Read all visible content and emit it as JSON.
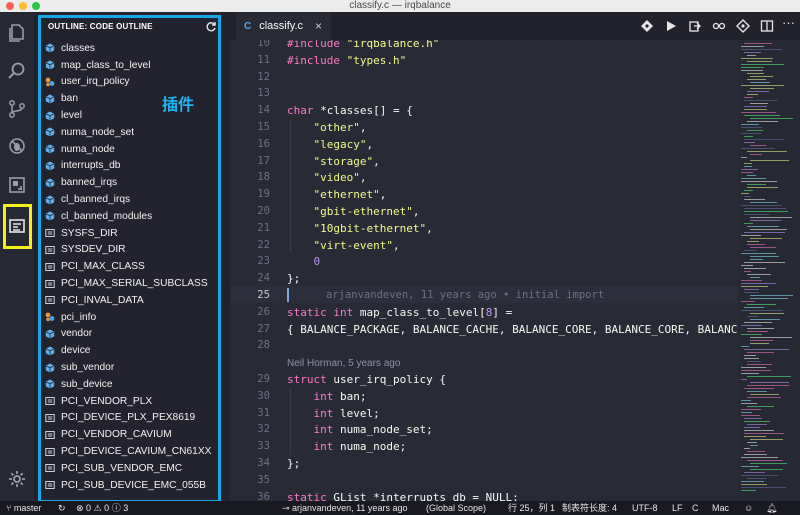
{
  "window": {
    "title": "classify.c — irqbalance"
  },
  "sidebar": {
    "header": "OUTLINE: CODE OUTLINE",
    "annotation": "插件",
    "items": [
      {
        "label": "classes",
        "icon": "variable-icon"
      },
      {
        "label": "map_class_to_level",
        "icon": "variable-icon"
      },
      {
        "label": "user_irq_policy",
        "icon": "struct-icon"
      },
      {
        "label": "ban",
        "icon": "field-icon"
      },
      {
        "label": "level",
        "icon": "field-icon"
      },
      {
        "label": "numa_node_set",
        "icon": "field-icon"
      },
      {
        "label": "numa_node",
        "icon": "field-icon"
      },
      {
        "label": "interrupts_db",
        "icon": "variable-icon"
      },
      {
        "label": "banned_irqs",
        "icon": "variable-icon"
      },
      {
        "label": "cl_banned_irqs",
        "icon": "variable-icon"
      },
      {
        "label": "cl_banned_modules",
        "icon": "variable-icon"
      },
      {
        "label": "SYSFS_DIR",
        "icon": "constant-icon"
      },
      {
        "label": "SYSDEV_DIR",
        "icon": "constant-icon"
      },
      {
        "label": "PCI_MAX_CLASS",
        "icon": "constant-icon"
      },
      {
        "label": "PCI_MAX_SERIAL_SUBCLASS",
        "icon": "constant-icon"
      },
      {
        "label": "PCI_INVAL_DATA",
        "icon": "constant-icon"
      },
      {
        "label": "pci_info",
        "icon": "struct-icon"
      },
      {
        "label": "vendor",
        "icon": "field-icon"
      },
      {
        "label": "device",
        "icon": "field-icon"
      },
      {
        "label": "sub_vendor",
        "icon": "field-icon"
      },
      {
        "label": "sub_device",
        "icon": "field-icon"
      },
      {
        "label": "PCI_VENDOR_PLX",
        "icon": "constant-icon"
      },
      {
        "label": "PCI_DEVICE_PLX_PEX8619",
        "icon": "constant-icon"
      },
      {
        "label": "PCI_VENDOR_CAVIUM",
        "icon": "constant-icon"
      },
      {
        "label": "PCI_DEVICE_CAVIUM_CN61XX",
        "icon": "constant-icon"
      },
      {
        "label": "PCI_SUB_VENDOR_EMC",
        "icon": "constant-icon"
      },
      {
        "label": "PCI_SUB_DEVICE_EMC_055B",
        "icon": "constant-icon"
      }
    ]
  },
  "tab": {
    "label": "classify.c",
    "lang": "C",
    "close": "×"
  },
  "editor": {
    "lines": [
      {
        "n": "10",
        "tokens": [
          {
            "t": "#include ",
            "c": "kw"
          },
          {
            "t": "\"irqbalance.h\"",
            "c": "str"
          }
        ]
      },
      {
        "n": "11",
        "tokens": [
          {
            "t": "#include ",
            "c": "kw"
          },
          {
            "t": "\"types.h\"",
            "c": "str"
          }
        ]
      },
      {
        "n": "12",
        "tokens": []
      },
      {
        "n": "13",
        "tokens": []
      },
      {
        "n": "14",
        "tokens": [
          {
            "t": "char ",
            "c": "kw"
          },
          {
            "t": "*classes[] = {",
            "c": "plain"
          }
        ]
      },
      {
        "n": "15",
        "tokens": [
          {
            "t": "    ",
            "c": "plain"
          },
          {
            "t": "\"other\"",
            "c": "str"
          },
          {
            "t": ",",
            "c": "plain"
          }
        ]
      },
      {
        "n": "16",
        "tokens": [
          {
            "t": "    ",
            "c": "plain"
          },
          {
            "t": "\"legacy\"",
            "c": "str"
          },
          {
            "t": ",",
            "c": "plain"
          }
        ]
      },
      {
        "n": "17",
        "tokens": [
          {
            "t": "    ",
            "c": "plain"
          },
          {
            "t": "\"storage\"",
            "c": "str"
          },
          {
            "t": ",",
            "c": "plain"
          }
        ]
      },
      {
        "n": "18",
        "tokens": [
          {
            "t": "    ",
            "c": "plain"
          },
          {
            "t": "\"video\"",
            "c": "str"
          },
          {
            "t": ",",
            "c": "plain"
          }
        ]
      },
      {
        "n": "19",
        "tokens": [
          {
            "t": "    ",
            "c": "plain"
          },
          {
            "t": "\"ethernet\"",
            "c": "str"
          },
          {
            "t": ",",
            "c": "plain"
          }
        ]
      },
      {
        "n": "20",
        "tokens": [
          {
            "t": "    ",
            "c": "plain"
          },
          {
            "t": "\"gbit-ethernet\"",
            "c": "str"
          },
          {
            "t": ",",
            "c": "plain"
          }
        ]
      },
      {
        "n": "21",
        "tokens": [
          {
            "t": "    ",
            "c": "plain"
          },
          {
            "t": "\"10gbit-ethernet\"",
            "c": "str"
          },
          {
            "t": ",",
            "c": "plain"
          }
        ]
      },
      {
        "n": "22",
        "tokens": [
          {
            "t": "    ",
            "c": "plain"
          },
          {
            "t": "\"virt-event\"",
            "c": "str"
          },
          {
            "t": ",",
            "c": "plain"
          }
        ]
      },
      {
        "n": "23",
        "tokens": [
          {
            "t": "    ",
            "c": "plain"
          },
          {
            "t": "0",
            "c": "num"
          }
        ]
      },
      {
        "n": "24",
        "tokens": [
          {
            "t": "};",
            "c": "plain"
          }
        ]
      },
      {
        "n": "25",
        "tokens": [],
        "blame": "arjanvandeven, 11 years ago • initial import"
      },
      {
        "n": "26",
        "tokens": [
          {
            "t": "static int ",
            "c": "kw"
          },
          {
            "t": "map_class_to_level[",
            "c": "plain"
          },
          {
            "t": "8",
            "c": "num"
          },
          {
            "t": "] =",
            "c": "plain"
          }
        ]
      },
      {
        "n": "27",
        "tokens": [
          {
            "t": "{ BALANCE_PACKAGE, BALANCE_CACHE, BALANCE_CORE, BALANCE_CORE, BALANCE_C",
            "c": "plain"
          }
        ]
      },
      {
        "n": "28",
        "tokens": []
      },
      {
        "n": "",
        "lens": "Neil Horman, 5 years ago"
      },
      {
        "n": "29",
        "tokens": [
          {
            "t": "struct ",
            "c": "kw"
          },
          {
            "t": "user_irq_policy {",
            "c": "plain"
          }
        ]
      },
      {
        "n": "30",
        "tokens": [
          {
            "t": "    ",
            "c": "plain"
          },
          {
            "t": "int ",
            "c": "kw"
          },
          {
            "t": "ban;",
            "c": "plain"
          }
        ]
      },
      {
        "n": "31",
        "tokens": [
          {
            "t": "    ",
            "c": "plain"
          },
          {
            "t": "int ",
            "c": "kw"
          },
          {
            "t": "level;",
            "c": "plain"
          }
        ]
      },
      {
        "n": "32",
        "tokens": [
          {
            "t": "    ",
            "c": "plain"
          },
          {
            "t": "int ",
            "c": "kw"
          },
          {
            "t": "numa_node_set;",
            "c": "plain"
          }
        ]
      },
      {
        "n": "33",
        "tokens": [
          {
            "t": "    ",
            "c": "plain"
          },
          {
            "t": "int ",
            "c": "kw"
          },
          {
            "t": "numa_node;",
            "c": "plain"
          }
        ]
      },
      {
        "n": "34",
        "tokens": [
          {
            "t": "};",
            "c": "plain"
          }
        ]
      },
      {
        "n": "35",
        "tokens": []
      },
      {
        "n": "36",
        "tokens": [
          {
            "t": "static ",
            "c": "kw"
          },
          {
            "t": "GList *interrupts_db = NULL;",
            "c": "plain"
          }
        ]
      }
    ]
  },
  "status": {
    "branch": "master",
    "sync": "↻",
    "errors": "0",
    "warnings": "0",
    "info": "3",
    "blame": "arjanvandeven, 11 years ago",
    "scope": "(Global Scope)",
    "position": "行 25，列 1",
    "tab_size": "制表符长度: 4",
    "encoding": "UTF-8",
    "eol": "LF",
    "language": "C",
    "platform": "Mac"
  },
  "colors": {
    "accent_annotation": "#17a7e4",
    "highlight_box": "#f4ef18",
    "keyword": "#ff79c6",
    "string": "#f1fa8c",
    "number": "#bd93f9"
  }
}
